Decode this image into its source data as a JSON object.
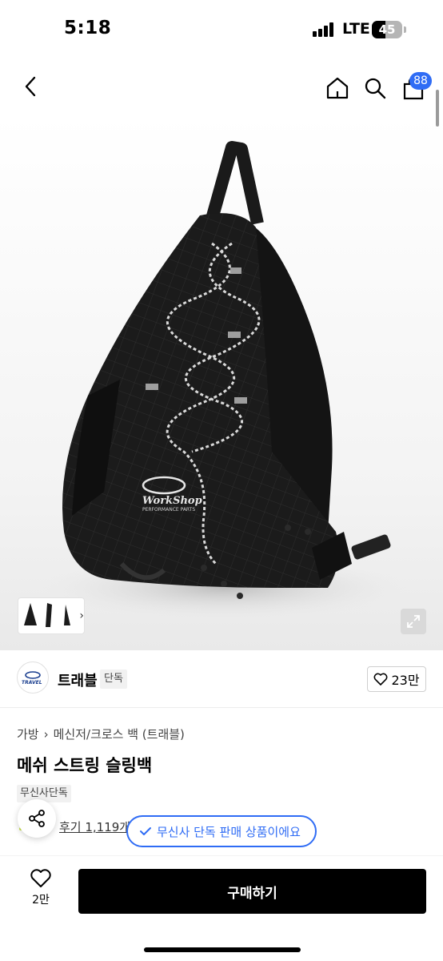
{
  "status_bar": {
    "time": "5:18",
    "network": "LTE",
    "battery_level": "45",
    "battery_fraction": 0.45,
    "signal_bars": 4
  },
  "nav": {
    "back_icon": "chevron-left-icon",
    "home_icon": "home-icon",
    "search_icon": "search-icon",
    "cart_icon": "shopping-bag-icon",
    "cart_badge": "88"
  },
  "product_image": {
    "logo_text": "WorkShop",
    "logo_subtext": "PERFORMANCE PARTS"
  },
  "brand": {
    "logo_text": "TRAVEL",
    "name": "트래블",
    "tag": "단독",
    "like_count": "23만"
  },
  "product": {
    "breadcrumb": [
      "가방",
      "메신저/크로스 백 (트래블)"
    ],
    "title": "메쉬 스트링 슬링백",
    "exclusive_badge": "무신사단독",
    "review_text": "후기 1,119개"
  },
  "toast": {
    "text": "무신사 단독 판매 상품이에요"
  },
  "bottom_bar": {
    "wish_count": "2만",
    "buy_label": "구매하기"
  },
  "colors": {
    "accent_blue": "#2f6cf5",
    "buy_button": "#000000"
  }
}
